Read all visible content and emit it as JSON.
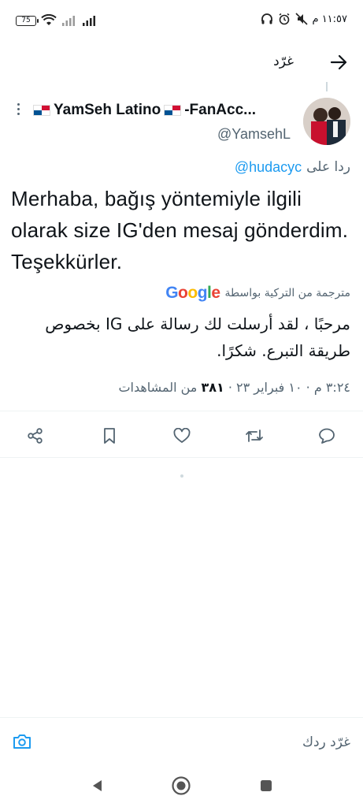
{
  "status_bar": {
    "battery": "75",
    "time": "١١:٥٧ م"
  },
  "topbar": {
    "title": "غرّد"
  },
  "tweet": {
    "author_name": "YamSeh Latino",
    "author_name_suffix": "-FanAcc...",
    "handle": "@YamsehL",
    "reply_prefix": "ردا على",
    "reply_to": "@hudacyc",
    "text": "Merhaba, bağış yöntemiyle ilgili olarak size IG'den mesaj gönderdim. Teşekkürler.",
    "translated_label": "مترجمة من التركية بواسطة",
    "translation": "مرحبًا ، لقد أرسلت لك رسالة على IG بخصوص طريقة التبرع. شكرًا.",
    "timestamp": "٣:٢٤ م · ١٠ فبراير ٢٣ · ",
    "views_count": "٣٨١",
    "views_label": " من المشاهدات"
  },
  "google_logo": {
    "letters": [
      "G",
      "o",
      "o",
      "g",
      "l",
      "e"
    ],
    "colors": [
      "#4285F4",
      "#EA4335",
      "#FBBC05",
      "#4285F4",
      "#34A853",
      "#EA4335"
    ]
  },
  "reply_bar": {
    "placeholder": "غرّد ردك"
  },
  "colors": {
    "accent": "#1d9bf0",
    "secondary_text": "#536471",
    "divider": "#eff3f4"
  },
  "icons": {
    "share": "share-icon",
    "bookmark": "bookmark-icon",
    "like": "heart-icon",
    "retweet": "retweet-icon",
    "reply": "reply-icon",
    "camera": "camera-icon",
    "back": "arrow-icon"
  }
}
